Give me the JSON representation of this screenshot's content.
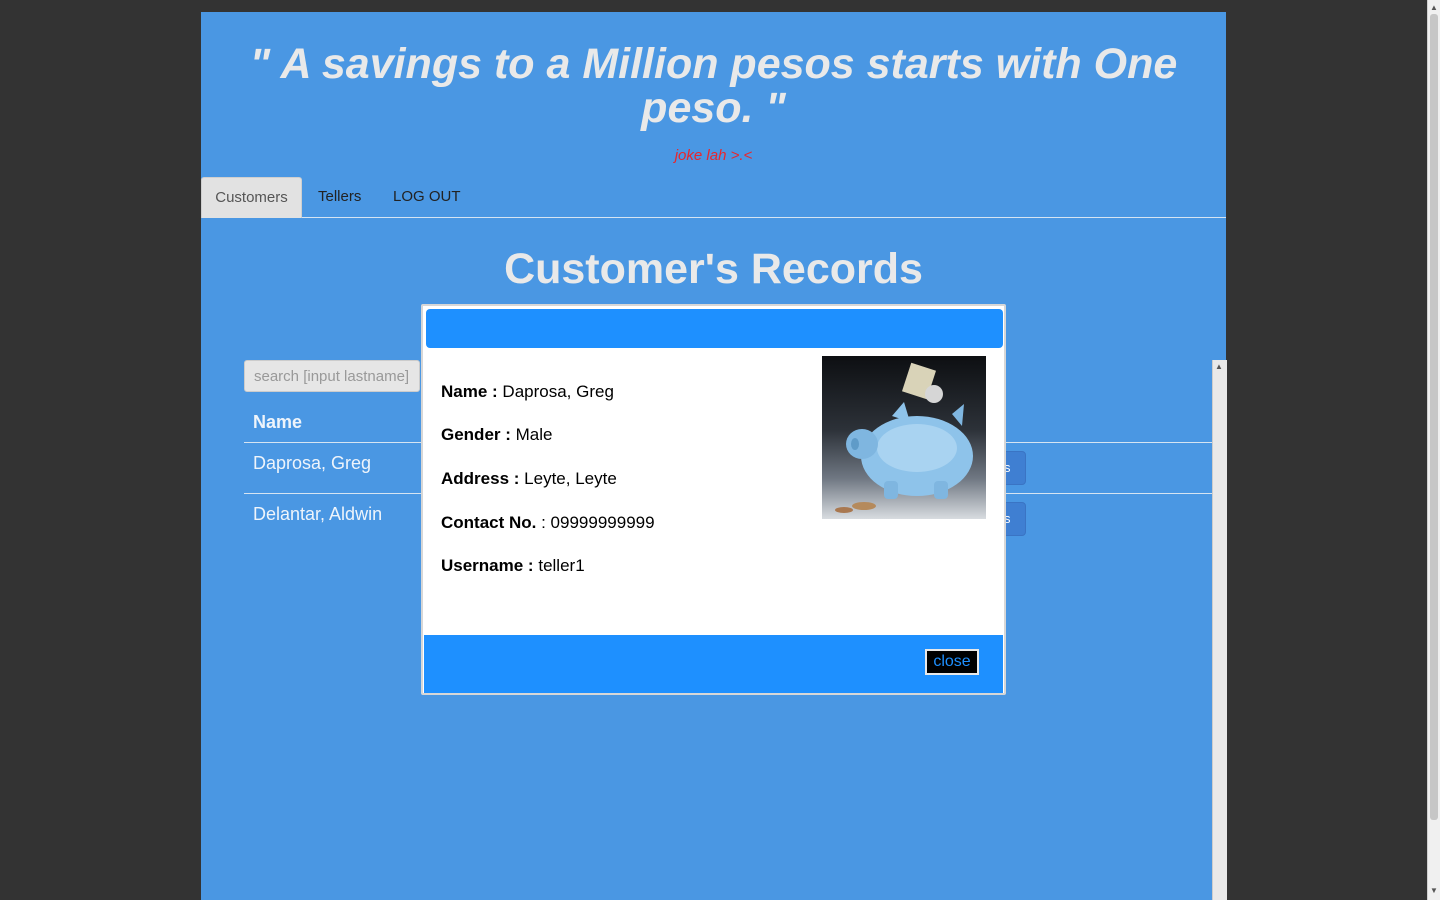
{
  "header": {
    "quote": "\" A savings to a Million pesos starts with One peso. \"",
    "note": "joke lah >.<"
  },
  "nav": {
    "tabs": [
      {
        "label": "Customers",
        "active": true
      },
      {
        "label": "Tellers",
        "active": false
      },
      {
        "label": "LOG OUT",
        "active": false
      }
    ]
  },
  "main": {
    "title": "Customer's Records",
    "search_placeholder": "search [input lastname]",
    "column_name": "Name",
    "rows": [
      {
        "name": "Daprosa, Greg",
        "action": "s"
      },
      {
        "name": "Delantar, Aldwin",
        "action": "s"
      }
    ]
  },
  "modal": {
    "fields": [
      {
        "label": "Name :",
        "value": "Daprosa, Greg"
      },
      {
        "label": "Gender :",
        "value": "Male"
      },
      {
        "label": "Address :",
        "value": "Leyte, Leyte"
      },
      {
        "label": "Contact No.",
        "value": " : 09999999999"
      },
      {
        "label": "Username :",
        "value": "teller1"
      }
    ],
    "photo_icon": "piggy-bank-image",
    "close_label": "close"
  },
  "colors": {
    "page_bg": "#4a97e3",
    "modal_bar": "#1e90ff",
    "note_red": "#e8262c",
    "backdrop": "#333333"
  }
}
